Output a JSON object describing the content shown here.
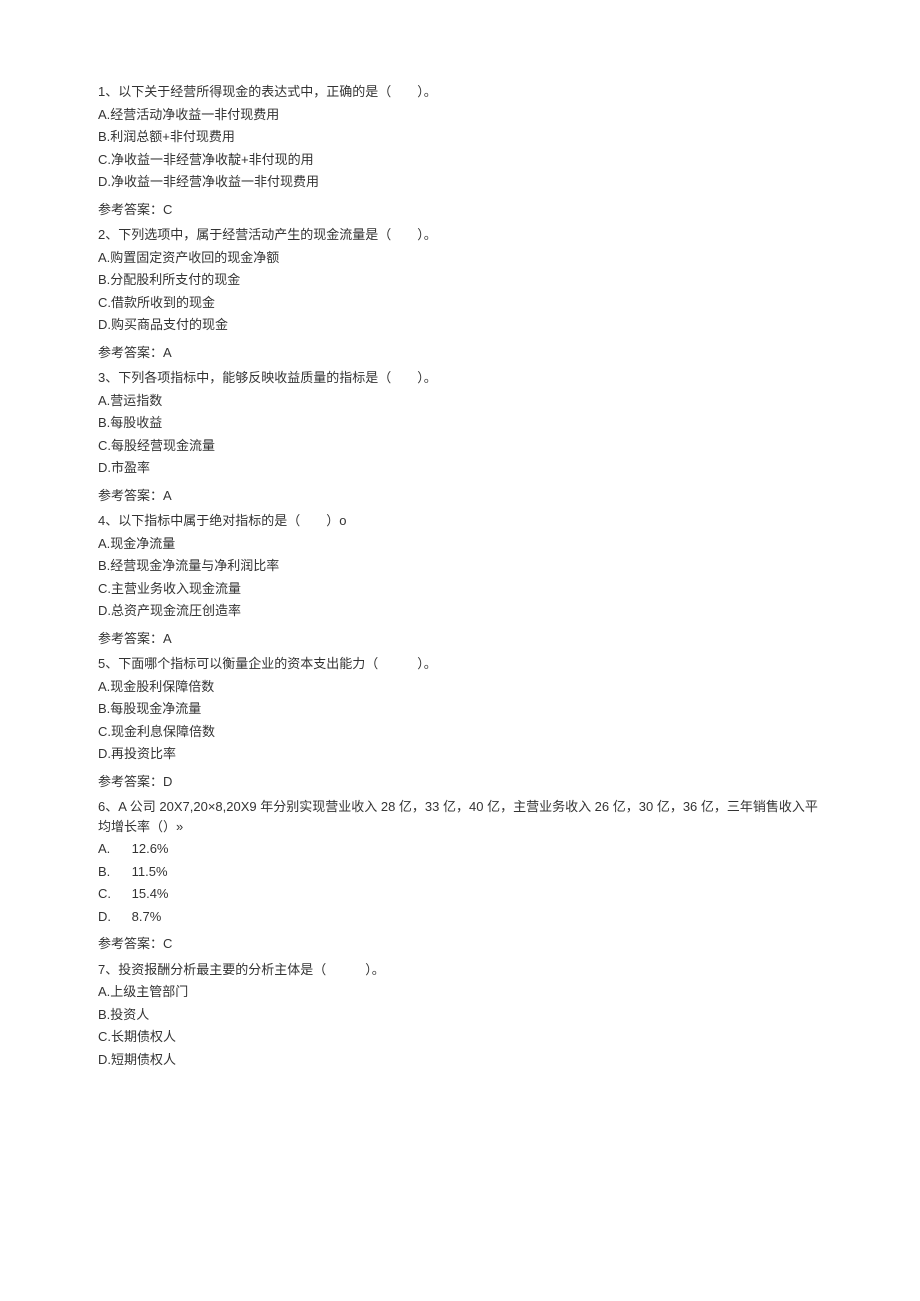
{
  "questions": [
    {
      "stem": "1、以下关于经营所得现金的表达式中，正确的是（　　）。",
      "options": [
        "A.经营活动净收益一非付现费用",
        "B.利润总额+非付现费用",
        "C.净收益一非经营净收靛+非付现的用",
        "D.净收益一非经营净收益一非付现费用"
      ],
      "answer": "参考答案：C"
    },
    {
      "stem": "2、下列选项中，属于经营活动产生的现金流量是（　　）。",
      "options": [
        "A.购置固定资产收回的现金净额",
        "B.分配股利所支付的现金",
        "C.借款所收到的现金",
        "D.购买商品支付的现金"
      ],
      "answer": "参考答案：A"
    },
    {
      "stem": "3、下列各项指标中，能够反映收益质量的指标是（　　）。",
      "options": [
        "A.营运指数",
        "B.每股收益",
        "C.每股经营现金流量",
        "D.市盈率"
      ],
      "answer": "参考答案：A"
    },
    {
      "stem": "4、以下指标中属于绝对指标的是（　　）o",
      "options": [
        "A.现金净流量",
        "B.经营现金净流量与净利润比率",
        "C.主营业务收入现金流量",
        "D.总资产现金流圧创造率"
      ],
      "answer": "参考答案：A"
    },
    {
      "stem": "5、下面哪个指标可以衡量企业的资本支出能力（　　　）。",
      "options": [
        "A.现金股利保障倍数",
        "B.每股现金净流量",
        "C.现金利息保障倍数",
        "D.再投资比率"
      ],
      "answer": "参考答案：D"
    },
    {
      "stem": "6、A 公司 20X7,20×8,20X9 年分别实现营业收入 28 亿，33 亿，40 亿，主营业务收入 26 亿，30 亿，36 亿，三年销售收入平均增长率（）»",
      "optionsLettered": [
        {
          "letter": "A.",
          "value": "12.6%"
        },
        {
          "letter": "B.",
          "value": "11.5%"
        },
        {
          "letter": "C.",
          "value": "15.4%"
        },
        {
          "letter": "D.",
          "value": "8.7%"
        }
      ],
      "answer": "参考答案：C"
    },
    {
      "stem": "7、投资报酬分析最主要的分析主体是（　　　）。",
      "options": [
        "A.上级主管部门",
        "B.投资人",
        "C.长期债权人",
        "D.短期债权人"
      ],
      "answer": ""
    }
  ]
}
